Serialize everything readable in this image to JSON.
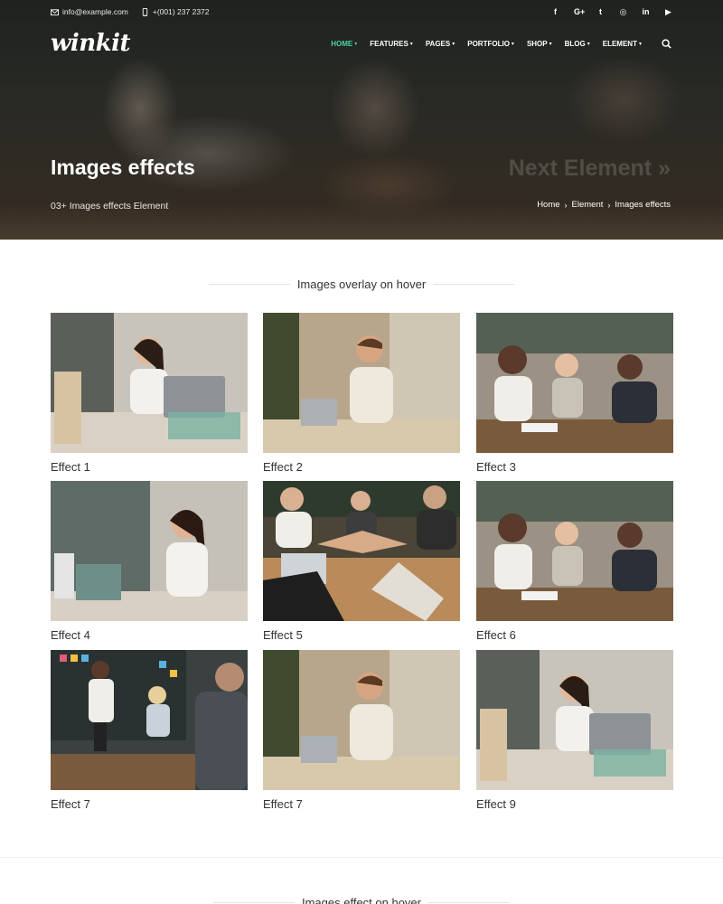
{
  "topbar": {
    "email": "info@example.com",
    "phone": "+(001) 237 2372",
    "social": [
      {
        "icon": "facebook-icon",
        "glyph": "f"
      },
      {
        "icon": "google-plus-icon",
        "glyph": "G+"
      },
      {
        "icon": "twitter-icon",
        "glyph": "t"
      },
      {
        "icon": "instagram-icon",
        "glyph": "◎"
      },
      {
        "icon": "linkedin-icon",
        "glyph": "in"
      },
      {
        "icon": "youtube-icon",
        "glyph": "▶"
      }
    ]
  },
  "header": {
    "logo": "winkit",
    "menu": [
      "HOME",
      "FEATURES",
      "PAGES",
      "PORTFOLIO",
      "SHOP",
      "BLOG",
      "ELEMENT"
    ],
    "active_menu": "HOME",
    "accent": "#4cd3a0"
  },
  "hero": {
    "title": "Images effects",
    "subtitle": "03+ Images effects Element",
    "next_label": "Next Element »",
    "breadcrumb": [
      "Home",
      "Element",
      "Images effects"
    ]
  },
  "section": {
    "title": "Images overlay on hover",
    "items": [
      {
        "caption": "Effect 1",
        "scene": "woman-laptop"
      },
      {
        "caption": "Effect 2",
        "scene": "man-laptop"
      },
      {
        "caption": "Effect 3",
        "scene": "meeting"
      },
      {
        "caption": "Effect 4",
        "scene": "woman-writing"
      },
      {
        "caption": "Effect 5",
        "scene": "team-hands"
      },
      {
        "caption": "Effect 6",
        "scene": "meeting"
      },
      {
        "caption": "Effect 7",
        "scene": "presentation"
      },
      {
        "caption": "Effect 7",
        "scene": "man-laptop"
      },
      {
        "caption": "Effect 9",
        "scene": "woman-laptop"
      }
    ]
  },
  "section2": {
    "title": "Images effect on hover"
  }
}
